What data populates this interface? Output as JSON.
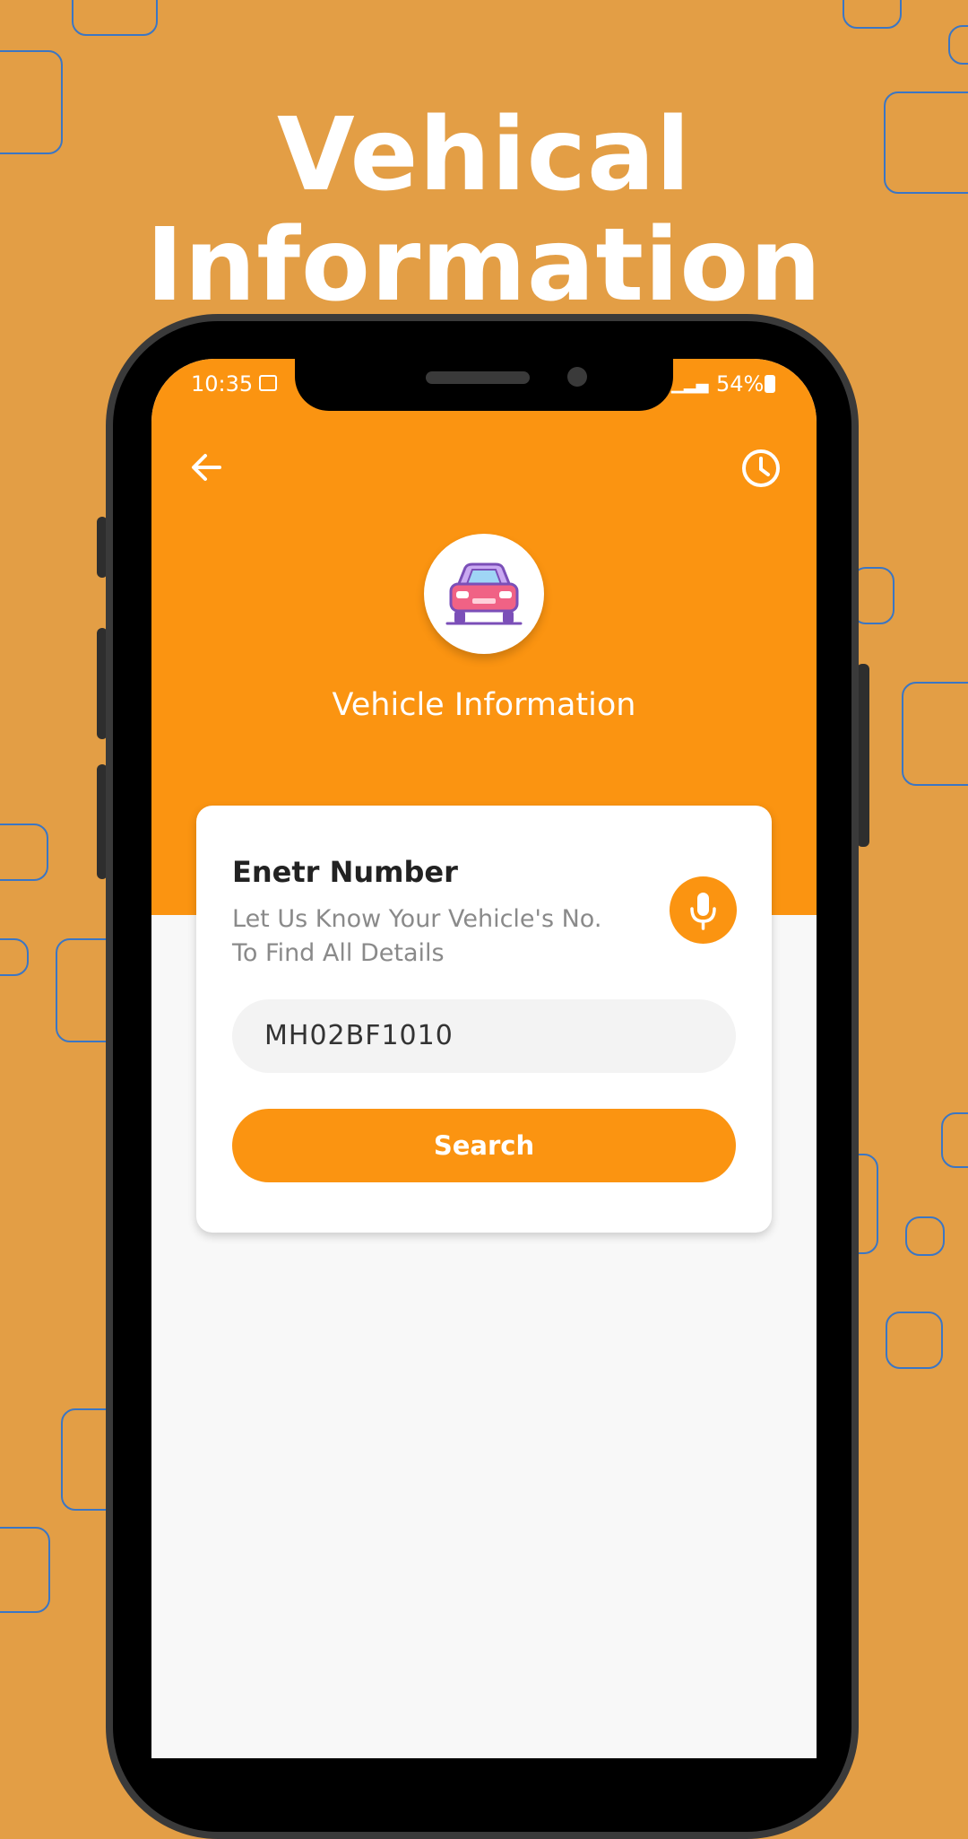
{
  "promo": {
    "headline": "Vehical Information"
  },
  "status_bar": {
    "time": "10:35",
    "battery": "54%"
  },
  "header": {
    "back_icon": "arrow-left-icon",
    "history_icon": "clock-icon",
    "avatar_icon": "car-icon",
    "title": "Vehicle Information"
  },
  "card": {
    "title": "Enetr Number",
    "subtitle_line1": "Let Us Know Your Vehicle's No.",
    "subtitle_line2": "To Find All Details",
    "mic_icon": "microphone-icon",
    "input_value": "MH02BF1010",
    "search_label": "Search"
  },
  "colors": {
    "background": "#E39E45",
    "accent": "#FB9411",
    "deco_outline": "#3B76C4"
  }
}
